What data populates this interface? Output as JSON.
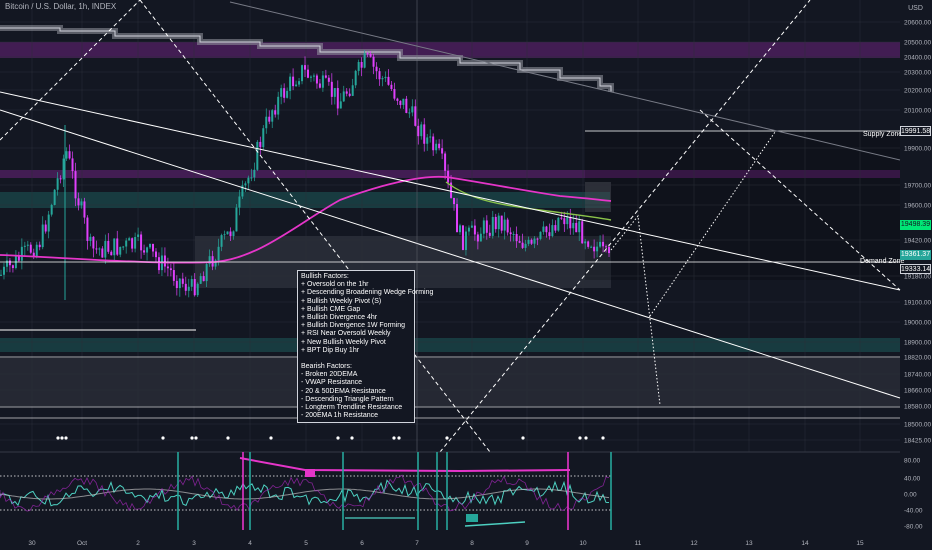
{
  "header": {
    "symbol_line": "Bitcoin / U.S. Dollar, 1h, INDEX"
  },
  "currency": "USD",
  "chart_data": {
    "type": "candlestick",
    "title": "Bitcoin / U.S. Dollar, 1h, INDEX",
    "price_axis": {
      "unit": "USD",
      "ticks": [
        20600,
        20500,
        20400,
        20300,
        20200,
        20100,
        19900,
        19700,
        19600,
        19420,
        19180,
        19100,
        19000,
        18900,
        18820,
        18740,
        18660,
        18580,
        18500,
        18425
      ],
      "range": [
        18425,
        20680
      ]
    },
    "time_axis": {
      "ticks": [
        "30",
        "Oct",
        "2",
        "3",
        "4",
        "5",
        "6",
        "7",
        "8",
        "9",
        "10",
        "11",
        "12",
        "13",
        "14",
        "15"
      ]
    },
    "indicator_axis": {
      "ticks": [
        80,
        40,
        0,
        -40,
        -80
      ],
      "range": [
        -95,
        95
      ]
    },
    "price_tags": [
      {
        "label": "19991.58",
        "value": 19991.58,
        "style": "outline"
      },
      {
        "label": "19498.39",
        "value": 19498.39,
        "style": "green"
      },
      {
        "label": "19361.37",
        "value": 19361.37,
        "style": "teal"
      },
      {
        "label": "19333.14",
        "value": 19333.14,
        "style": "outline"
      }
    ],
    "levels": [
      {
        "name": "Supply Zone",
        "value": 19991.58
      },
      {
        "name": "Demand Zone",
        "value": 19361.37
      }
    ],
    "annotations": {
      "bullish_title": "Bullish Factors:",
      "bullish": [
        "+ Oversold on the 1hr",
        "+ Descending Broadening Wedge Forming",
        "+ Bullish Weekly Pivot (S)",
        "+ Bullish CME Gap",
        "+ Bullish Divergence 4hr",
        "+ Bullish Divergence 1W Forming",
        "+ RSI Near Oversold Weekly",
        "+ New Bullish Weekly Pivot",
        "+ BPT Dip Buy 1hr"
      ],
      "bearish_title": "Bearish Factors:",
      "bearish": [
        "- Broken 20DEMA",
        "- VWAP Resistance",
        "- 20 & 50DEMA Resistance",
        "- Descending Triangle Pattern",
        "- Longterm Trendline Resistance",
        "- 200EMA 1h Resistance"
      ]
    },
    "colors": {
      "background": "#131722",
      "bull": "#26a69a",
      "bear": "#e040fb",
      "ema": "#e535c9",
      "trend": "#ffffff",
      "supply": "#9c27b0",
      "demand": "#26a69a"
    }
  }
}
